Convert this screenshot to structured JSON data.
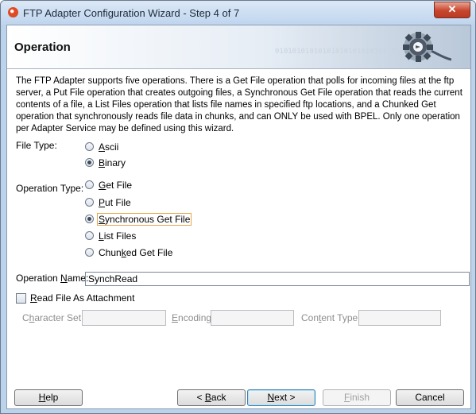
{
  "window": {
    "title": "FTP Adapter Configuration Wizard - Step 4 of 7",
    "close_symbol": "✕"
  },
  "banner": {
    "title": "Operation",
    "binary_text": "01010101010101010101010101 01"
  },
  "description": "The FTP Adapter supports five operations.  There is a Get File operation that polls for incoming files at the ftp server, a Put File operation that creates outgoing files, a Synchronous Get File operation that reads the current contents of a file, a List Files operation that lists file names in specified ftp locations, and a Chunked Get operation that synchronously reads file data in chunks, and can ONLY be used with BPEL. Only one operation per Adapter Service may be defined using this wizard.",
  "file_type": {
    "label": "File Type:",
    "options": [
      {
        "pre": "",
        "key": "A",
        "post": "scii",
        "selected": false
      },
      {
        "pre": "",
        "key": "B",
        "post": "inary",
        "selected": true
      }
    ]
  },
  "operation_type": {
    "label": "Operation Type:",
    "options": [
      {
        "pre": "",
        "key": "G",
        "post": "et File",
        "selected": false
      },
      {
        "pre": "",
        "key": "P",
        "post": "ut File",
        "selected": false
      },
      {
        "pre": "",
        "key": "S",
        "post": "ynchronous Get File",
        "selected": true
      },
      {
        "pre": "",
        "key": "L",
        "post": "ist Files",
        "selected": false
      },
      {
        "pre": "Chun",
        "key": "k",
        "post": "ed Get File",
        "selected": false
      }
    ]
  },
  "operation_name": {
    "label_pre": "Operation ",
    "label_key": "N",
    "label_post": "ame:",
    "value": "SynchRead"
  },
  "read_as_attachment": {
    "label_pre": "",
    "label_key": "R",
    "label_post": "ead File As Attachment",
    "checked": false
  },
  "character_set": {
    "label_pre": "C",
    "label_key": "h",
    "label_post": "aracter Set:"
  },
  "encoding": {
    "label_pre": "",
    "label_key": "E",
    "label_post": "ncoding:"
  },
  "content_type": {
    "label_pre": "Con",
    "label_key": "t",
    "label_post": "ent Type:"
  },
  "buttons": {
    "help": {
      "pre": "",
      "key": "H",
      "post": "elp"
    },
    "back": {
      "pre": "< ",
      "key": "B",
      "post": "ack"
    },
    "next": {
      "pre": "",
      "key": "N",
      "post": "ext >"
    },
    "finish": {
      "pre": "",
      "key": "F",
      "post": "inish"
    },
    "cancel": {
      "pre": "Cancel",
      "key": "",
      "post": ""
    }
  }
}
